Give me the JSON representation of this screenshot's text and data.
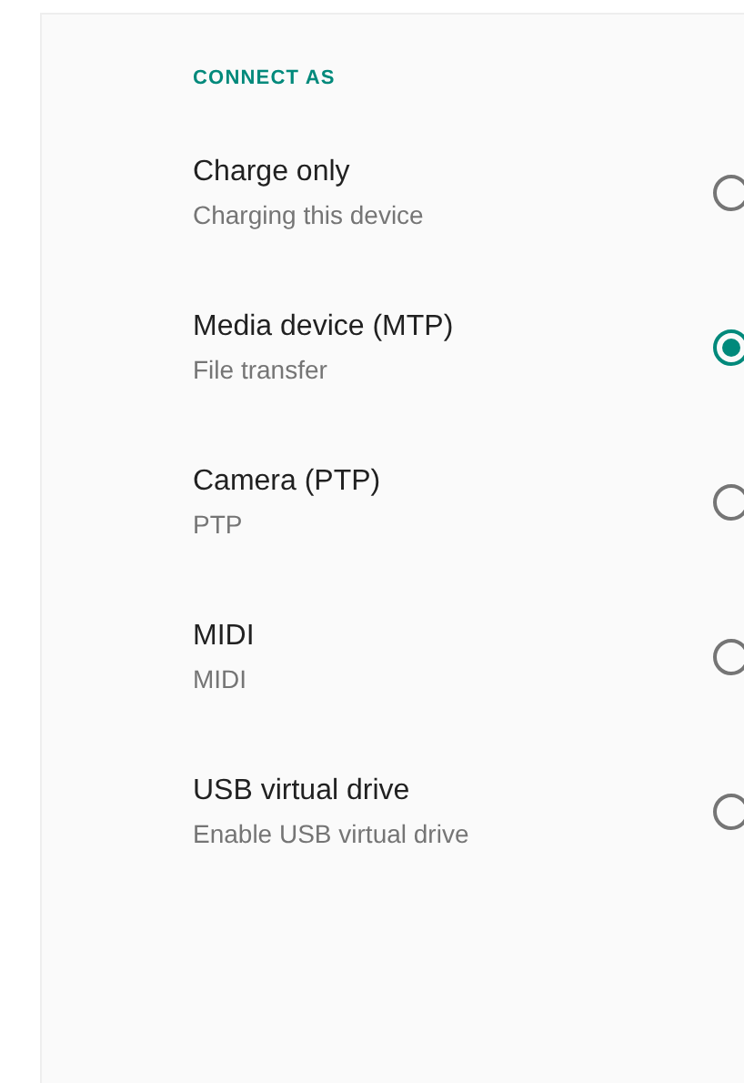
{
  "section": {
    "header": "CONNECT AS"
  },
  "options": [
    {
      "title": "Charge only",
      "subtitle": "Charging this device",
      "selected": false
    },
    {
      "title": "Media device (MTP)",
      "subtitle": "File transfer",
      "selected": true
    },
    {
      "title": "Camera (PTP)",
      "subtitle": "PTP",
      "selected": false
    },
    {
      "title": "MIDI",
      "subtitle": "MIDI",
      "selected": false
    },
    {
      "title": "USB virtual drive",
      "subtitle": "Enable USB virtual drive",
      "selected": false
    }
  ]
}
